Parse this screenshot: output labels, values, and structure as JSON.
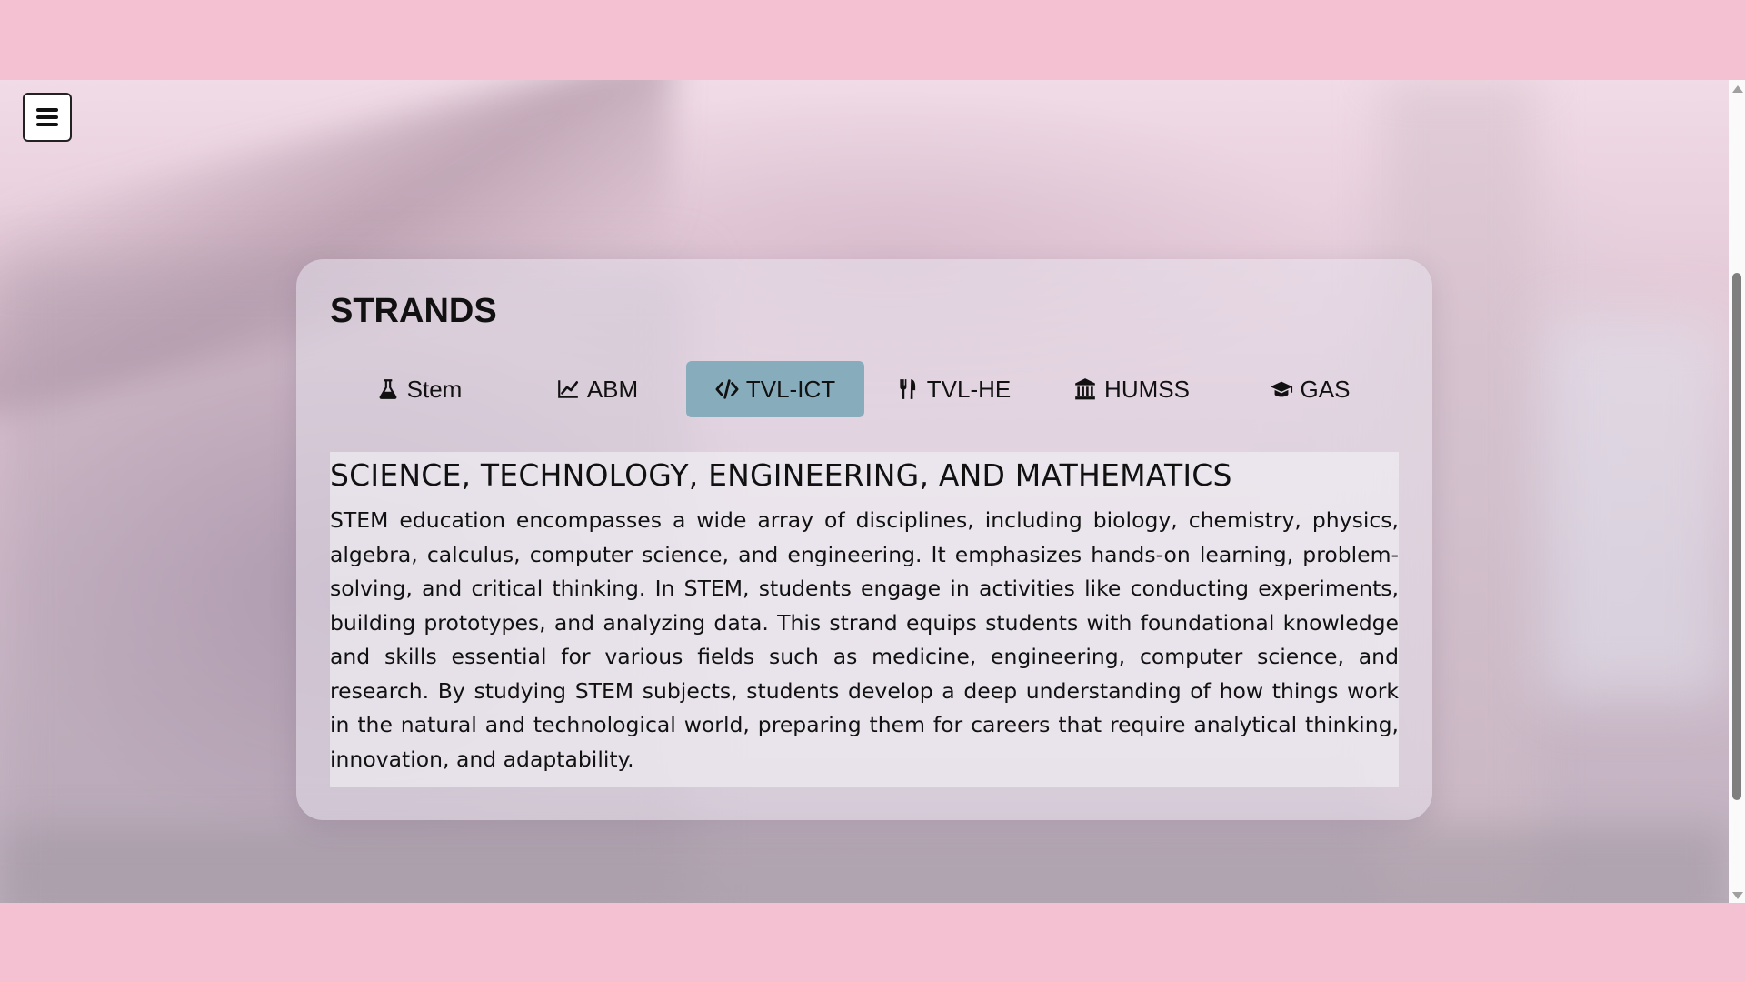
{
  "menu": {
    "icon": "hamburger-menu-icon"
  },
  "card": {
    "title": "STRANDS",
    "tabs": [
      {
        "label": "Stem",
        "icon": "flask-icon",
        "active": false
      },
      {
        "label": "ABM",
        "icon": "line-chart-icon",
        "active": false
      },
      {
        "label": "TVL-ICT",
        "icon": "code-icon",
        "active": true
      },
      {
        "label": "TVL-HE",
        "icon": "utensils-icon",
        "active": false
      },
      {
        "label": "HUMSS",
        "icon": "landmark-icon",
        "active": false
      },
      {
        "label": "GAS",
        "icon": "graduation-cap-icon",
        "active": false
      }
    ],
    "content": {
      "heading": "SCIENCE, TECHNOLOGY, ENGINEERING, AND MATHEMATICS",
      "body": "STEM education encompasses a wide array of disciplines, including biology, chemistry, physics, algebra, calculus, computer science, and engineering. It emphasizes hands-on learning, problem-solving, and critical thinking. In STEM, students engage in activities like conducting experiments, building prototypes, and analyzing data. This strand equips students with foundational knowledge and skills essential for various fields such as medicine, engineering, computer science, and research. By studying STEM subjects, students develop a deep understanding of how things work in the natural and technological world, preparing them for careers that require analytical thinking, innovation, and adaptability."
    }
  },
  "colors": {
    "frame": "#f4c1d3",
    "active_tab": "#87acbc",
    "text": "#111111"
  }
}
